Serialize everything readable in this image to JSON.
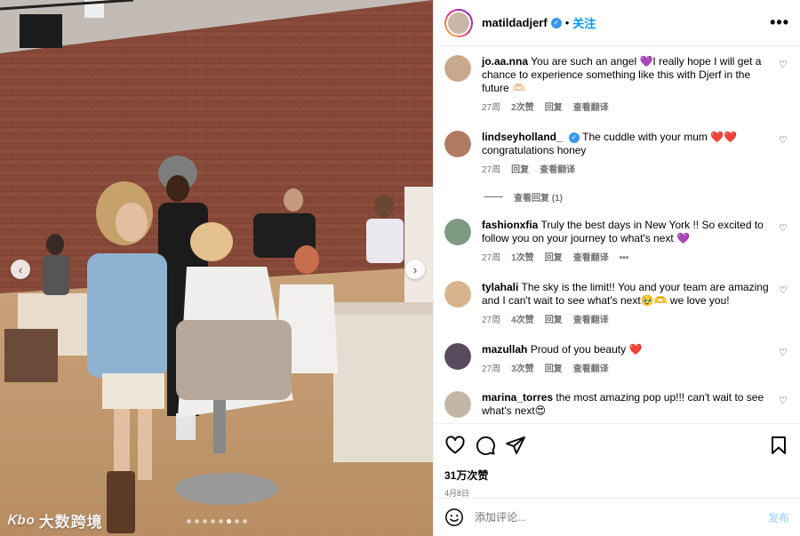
{
  "post": {
    "username": "matildadjerf",
    "separator": "•",
    "follow_label": "关注",
    "more_label": "•••",
    "likes": "31万次赞",
    "date": "4月8日"
  },
  "carousel": {
    "total_slides": 8,
    "active_slide": 5
  },
  "comments": [
    {
      "user": "jo.aa.nna",
      "text": "You are such an angel 💜I really hope I will get a chance to experience something like this with Djerf in the future 🫶🏻",
      "age": "27周",
      "likes": "2次赞",
      "reply": "回复",
      "translate": "查看翻译",
      "avatar_color": "#c9a98d"
    },
    {
      "user": "lindseyholland_",
      "verified": true,
      "text": "The cuddle with your mum ❤️❤️ congratulations honey",
      "age": "27周",
      "reply": "回复",
      "translate": "查看翻译",
      "avatar_color": "#b07a63"
    },
    {
      "user": "fashionxfia",
      "text": "Truly the best days in New York !! So excited to follow you on your journey to what's next 💜",
      "age": "27周",
      "likes": "1次赞",
      "reply": "回复",
      "translate": "查看翻译",
      "options": "•••",
      "avatar_color": "#7f9a82"
    },
    {
      "user": "tylahali",
      "text": "The sky is the limit!! You and your team are amazing and I can't wait to see what's next🥹🫶 we love you!",
      "age": "27周",
      "likes": "4次赞",
      "reply": "回复",
      "translate": "查看翻译",
      "avatar_color": "#d8b48e"
    },
    {
      "user": "mazullah",
      "text": "Proud of you beauty ❤️",
      "age": "27周",
      "likes": "3次赞",
      "reply": "回复",
      "translate": "查看翻译",
      "avatar_color": "#5a4a5e"
    },
    {
      "user": "marina_torres",
      "text": "the most amazing pop up!!! can't wait to see what's next😍",
      "avatar_color": "#c4b6a6"
    }
  ],
  "view_replies": "查看回复 (1)",
  "comment_box": {
    "placeholder": "添加评论...",
    "post_label": "发布"
  },
  "watermark": {
    "logo": "Ꮶbo",
    "text": "大数跨境"
  },
  "icons": {
    "like": "heart-icon",
    "comment": "comment-icon",
    "share": "paper-plane-icon",
    "save": "bookmark-icon",
    "emoji": "smiley-icon",
    "nav_left": "chevron-left-icon",
    "nav_right": "chevron-right-icon",
    "comment_like": "small-heart-icon"
  },
  "colors": {
    "accent": "#0095f6",
    "verified": "#3897f0",
    "meta_gray": "#737373",
    "brick": "#8b4a3a"
  }
}
